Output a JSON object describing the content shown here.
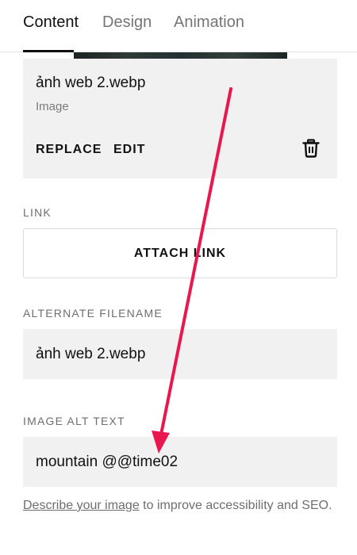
{
  "tabs": [
    {
      "label": "Content"
    },
    {
      "label": "Design"
    },
    {
      "label": "Animation"
    }
  ],
  "image": {
    "filename": "ảnh web 2.webp",
    "type": "Image",
    "replace_label": "REPLACE",
    "edit_label": "EDIT"
  },
  "link": {
    "label": "LINK",
    "button_label": "ATTACH LINK"
  },
  "alternate_filename": {
    "label": "ALTERNATE FILENAME",
    "value": "ảnh web 2.webp"
  },
  "alt_text": {
    "label": "IMAGE ALT TEXT",
    "value": "mountain @@time02"
  },
  "helper": {
    "link_text": "Describe your image",
    "rest_text": " to improve accessibility and SEO."
  },
  "colors": {
    "annotation_arrow": "#e8184f"
  },
  "icons": {
    "delete": "trash-icon"
  }
}
